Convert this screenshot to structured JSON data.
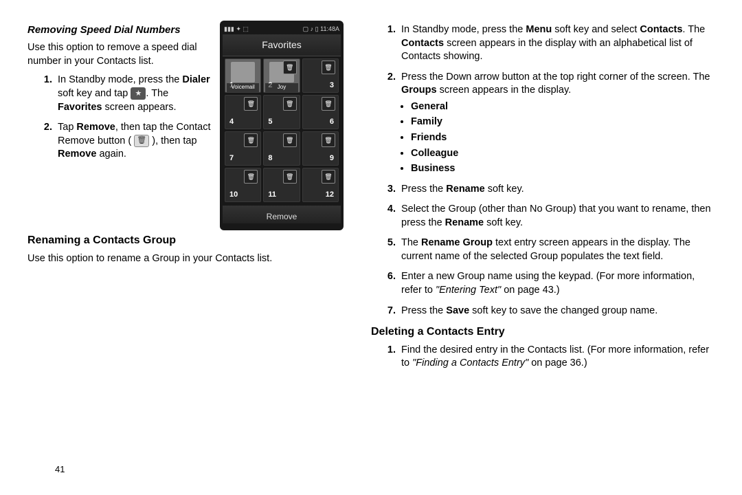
{
  "page_number": "41",
  "left": {
    "section1_title": "Removing Speed Dial Numbers",
    "section1_intro": "Use this option to remove a speed dial number in your Contacts list.",
    "step1_a": "In Standby mode, press the ",
    "step1_b": "Dialer",
    "step1_c": " soft key and tap ",
    "step1_d": ". The ",
    "step1_e": "Favorites",
    "step1_f": " screen appears.",
    "step2_a": "Tap ",
    "step2_b": "Remove",
    "step2_c": ", then tap the Contact Remove button ( ",
    "step2_d": " ), then tap ",
    "step2_e": "Remove",
    "step2_f": " again.",
    "section2_title": "Renaming a Contacts Group",
    "section2_intro": "Use this option to rename a Group in your Contacts list."
  },
  "phone": {
    "status_left": "▮▮▮  ✦ ⬚",
    "status_right": "▢ ♪ ▯ 11:48A",
    "title": "Favorites",
    "cells": [
      {
        "num": "1",
        "label": "Voicemail",
        "photo": true
      },
      {
        "num": "2",
        "label": "Joy",
        "photo": true,
        "trash": true
      },
      {
        "num": "3",
        "trash": true
      },
      {
        "num": "4",
        "trash": true
      },
      {
        "num": "5",
        "trash": true
      },
      {
        "num": "6",
        "trash": true
      },
      {
        "num": "7",
        "trash": true
      },
      {
        "num": "8",
        "trash": true
      },
      {
        "num": "9",
        "trash": true
      },
      {
        "num": "10",
        "trash": true
      },
      {
        "num": "11",
        "trash": true
      },
      {
        "num": "12",
        "trash": true
      }
    ],
    "remove_label": "Remove"
  },
  "right": {
    "step1_a": "In Standby mode, press the ",
    "step1_b": "Menu",
    "step1_c": " soft key and select ",
    "step1_d": "Contacts",
    "step1_e": ". The ",
    "step1_f": "Contacts",
    "step1_g": " screen appears in the display with an alphabetical list of Contacts showing.",
    "step2_a": "Press the Down arrow button at the top right corner of the screen. The ",
    "step2_b": "Groups",
    "step2_c": " screen appears in the display.",
    "groups": [
      "General",
      "Family",
      "Friends",
      "Colleague",
      "Business"
    ],
    "step3_a": "Press the ",
    "step3_b": "Rename",
    "step3_c": " soft key.",
    "step4_a": "Select the Group (other than No Group) that you want to rename, then press the ",
    "step4_b": "Rename",
    "step4_c": " soft key.",
    "step5_a": "The ",
    "step5_b": "Rename Group",
    "step5_c": " text entry screen appears in the display. The current name of the selected Group populates the text field.",
    "step6_a": "Enter a new Group name using the keypad. (For more information, refer to ",
    "step6_b": "\"Entering Text\"",
    "step6_c": " on page 43.)",
    "step7_a": "Press the ",
    "step7_b": "Save",
    "step7_c": " soft key to save the changed group name.",
    "section3_title": "Deleting a Contacts Entry",
    "del_step1_a": "Find the desired entry in the Contacts list. (For more information, refer to ",
    "del_step1_b": "\"Finding a Contacts Entry\"",
    "del_step1_c": " on page 36.)"
  }
}
